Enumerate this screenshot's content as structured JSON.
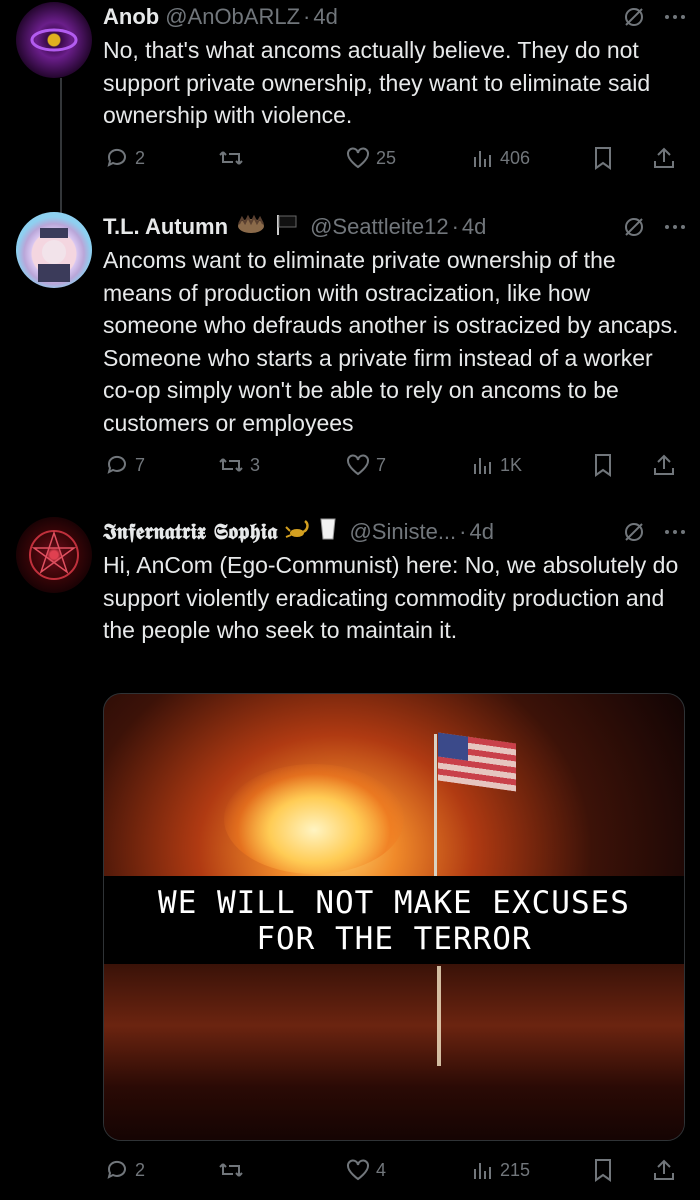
{
  "posts": [
    {
      "name": "Anob",
      "handle": "@AnObARLZ",
      "time": "4d",
      "text": "No, that's what ancoms actually believe. They do not support private ownership, they want to eliminate said ownership with violence.",
      "stats": {
        "replies": "2",
        "reposts": "",
        "likes": "25",
        "views": "406"
      }
    },
    {
      "name": "T.L. Autumn",
      "handle": "@Seattleite12",
      "time": "4d",
      "text": "Ancoms want to eliminate private ownership of the means of production with ostracization, like how someone who defrauds another is ostracized by ancaps. Someone who starts a private firm instead of a worker co-op simply won't be able to rely on ancoms to be customers or employees",
      "stats": {
        "replies": "7",
        "reposts": "3",
        "likes": "7",
        "views": "1K"
      }
    },
    {
      "name": "𝕴𝖓𝖋𝖊𝖗𝖓𝖆𝖙𝖗𝖎𝖝 𝕾𝖔𝖕𝖍𝖎𝖆",
      "handle": "@Siniste...",
      "time": "4d",
      "text": "Hi, AnCom (Ego-Communist) here: No, we absolutely do support violently eradicating commodity production and the people who seek to maintain it.",
      "media_caption": [
        "WE WILL NOT MAKE EXCUSES",
        "FOR THE TERROR"
      ],
      "stats": {
        "replies": "2",
        "reposts": "",
        "likes": "4",
        "views": "215"
      }
    }
  ],
  "separator": "·",
  "colors": {
    "background": "#000000",
    "text": "#e7e9ea",
    "muted": "#71767b"
  },
  "icons": [
    "reply-icon",
    "repost-icon",
    "like-icon",
    "views-icon",
    "bookmark-icon",
    "share-icon",
    "grok-icon",
    "more-icon"
  ]
}
